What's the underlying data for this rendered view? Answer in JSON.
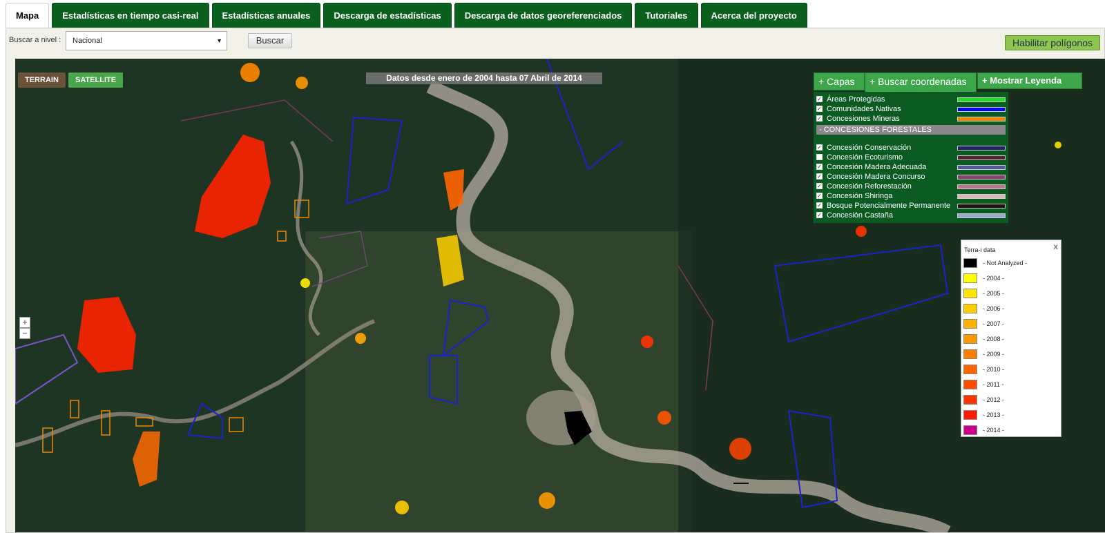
{
  "tabs": [
    {
      "label": "Mapa"
    },
    {
      "label": "Estadísticas en tiempo casi-real"
    },
    {
      "label": "Estadísticas anuales"
    },
    {
      "label": "Descarga de estadísticas"
    },
    {
      "label": "Descarga de datos georeferenciados"
    },
    {
      "label": "Tutoriales"
    },
    {
      "label": "Acerca del proyecto"
    }
  ],
  "toolbar": {
    "level_label": "Buscar a nivel :",
    "level_value": "Nacional",
    "search_label": "Buscar",
    "polygons_label": "Habilitar polígonos"
  },
  "map": {
    "terrain_label": "TERRAIN",
    "satellite_label": "SATELLITE",
    "date_banner": "Datos desde enero de 2004 hasta 07 Abril de 2014",
    "zoom_in": "+",
    "zoom_out": "−"
  },
  "controls": {
    "layers_label": "+ Capas",
    "coords_label": "+ Buscar coordenadas",
    "legend_label": "+ Mostrar Leyenda"
  },
  "layers": {
    "top": [
      {
        "label": "Áreas Protegidas",
        "checked": true,
        "color": "#22dd22"
      },
      {
        "label": "Comunidades Nativas",
        "checked": true,
        "color": "#0000ee"
      },
      {
        "label": "Concesiones Mineras",
        "checked": true,
        "color": "#ee8800"
      }
    ],
    "section_label": "- CONCESIONES FORESTALES",
    "forest": [
      {
        "label": "Concesión Conservación",
        "checked": true,
        "color": "#222266"
      },
      {
        "label": "Concesión Ecoturismo",
        "checked": false,
        "color": "#552233"
      },
      {
        "label": "Concesión Madera Adecuada",
        "checked": true,
        "color": "#555599"
      },
      {
        "label": "Concesión Madera Concurso",
        "checked": true,
        "color": "#884466"
      },
      {
        "label": "Concesión Reforestación",
        "checked": true,
        "color": "#bb7788"
      },
      {
        "label": "Concesión Shiringa",
        "checked": true,
        "color": "#d8b8b8"
      },
      {
        "label": "Bosque Potencialmente Permanente",
        "checked": true,
        "color": "#221111"
      },
      {
        "label": "Concesión Castaña",
        "checked": true,
        "color": "#99aacc"
      }
    ]
  },
  "legend": {
    "title": "Terra-i data",
    "close": "x",
    "items": [
      {
        "label": "- Not Analyzed -",
        "color": "#000000"
      },
      {
        "label": "- 2004 -",
        "color": "#ffff00"
      },
      {
        "label": "- 2005 -",
        "color": "#ffe600"
      },
      {
        "label": "- 2006 -",
        "color": "#ffcc00"
      },
      {
        "label": "- 2007 -",
        "color": "#ffb300"
      },
      {
        "label": "- 2008 -",
        "color": "#ff9900"
      },
      {
        "label": "- 2009 -",
        "color": "#ff8000"
      },
      {
        "label": "- 2010 -",
        "color": "#ff6600"
      },
      {
        "label": "- 2011 -",
        "color": "#ff4d00"
      },
      {
        "label": "- 2012 -",
        "color": "#ff3300"
      },
      {
        "label": "- 2013 -",
        "color": "#ff1a00"
      },
      {
        "label": "- 2014 -",
        "color": "#cc0088"
      }
    ]
  }
}
